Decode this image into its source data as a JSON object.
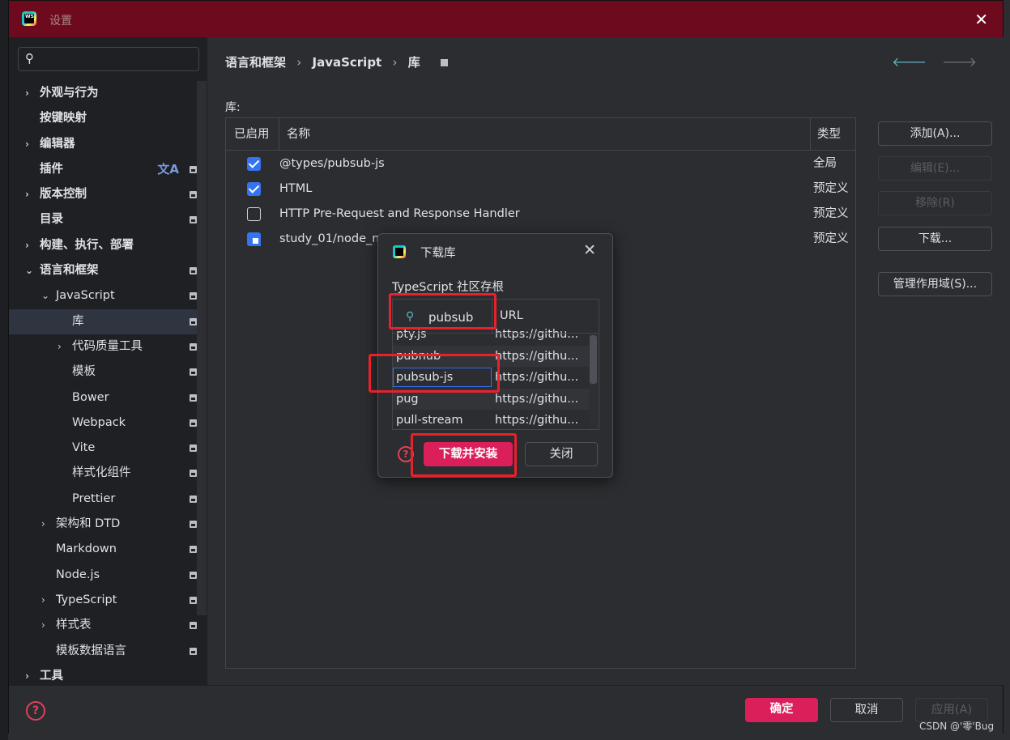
{
  "window": {
    "title": "设置",
    "close_glyph": "✕"
  },
  "sidebar": {
    "search_placeholder": "",
    "items": [
      {
        "label": "外观与行为",
        "chevron": "›",
        "bold": true
      },
      {
        "label": "按键映射",
        "bold": true
      },
      {
        "label": "编辑器",
        "chevron": "›",
        "bold": true
      },
      {
        "label": "插件",
        "bold": true
      },
      {
        "label": "版本控制",
        "chevron": "›",
        "bold": true
      },
      {
        "label": "目录",
        "bold": true
      },
      {
        "label": "构建、执行、部署",
        "chevron": "›",
        "bold": true
      },
      {
        "label": "语言和框架",
        "chevron": "⌄",
        "bold": true
      },
      {
        "label": "JavaScript",
        "chevron": "⌄"
      },
      {
        "label": "库"
      },
      {
        "label": "代码质量工具",
        "chevron": "›"
      },
      {
        "label": "模板"
      },
      {
        "label": "Bower"
      },
      {
        "label": "Webpack"
      },
      {
        "label": "Vite"
      },
      {
        "label": "样式化组件"
      },
      {
        "label": "Prettier"
      },
      {
        "label": "架构和 DTD",
        "chevron": "›"
      },
      {
        "label": "Markdown"
      },
      {
        "label": "Node.js"
      },
      {
        "label": "TypeScript",
        "chevron": "›"
      },
      {
        "label": "样式表",
        "chevron": "›"
      },
      {
        "label": "模板数据语言"
      },
      {
        "label": "工具",
        "chevron": "›",
        "bold": true
      }
    ]
  },
  "breadcrumb": [
    "语言和框架",
    "JavaScript",
    "库"
  ],
  "breadcrumb_sep": "›",
  "nav": {
    "back": "🡐",
    "forward": "🡒"
  },
  "libraries": {
    "label": "库:",
    "columns": [
      "已启用",
      "名称",
      "类型"
    ],
    "rows": [
      {
        "name": "@types/pubsub-js",
        "type": "全局",
        "state": "on"
      },
      {
        "name": "HTML",
        "type": "预定义",
        "state": "on"
      },
      {
        "name": "HTTP Pre-Request and Response Handler",
        "type": "预定义",
        "state": "off"
      },
      {
        "name": "study_01/node_m",
        "type": "预定义",
        "state": "partial"
      }
    ]
  },
  "side_buttons": [
    {
      "label": "添加(A)...",
      "enabled": true
    },
    {
      "label": "编辑(E)...",
      "enabled": false
    },
    {
      "label": "移除(R)",
      "enabled": false
    },
    {
      "label": "下载...",
      "enabled": true
    },
    {
      "label": "管理作用域(S)...",
      "enabled": true
    }
  ],
  "bottom": {
    "help": "?",
    "ok": "确定",
    "cancel": "取消",
    "apply": "应用(A)"
  },
  "dialog": {
    "title": "下载库",
    "subtitle": "TypeScript 社区存根",
    "search_value": "pubsub",
    "url_header": "URL",
    "rows": [
      {
        "name": "pty.js",
        "url": "https://githu..."
      },
      {
        "name": "pubnub",
        "url": "https://githu..."
      },
      {
        "name": "pubsub-js",
        "url": "https://githu...",
        "selected": true
      },
      {
        "name": "pug",
        "url": "https://githu..."
      },
      {
        "name": "pull-stream",
        "url": "https://githu..."
      }
    ],
    "help": "?",
    "primary": "下载并安装",
    "close": "关闭"
  },
  "watermark": "CSDN @'零'Bug",
  "colors": {
    "accent": "#db1f5b",
    "titlebar": "#6d0a1e",
    "checkbox": "#3574f0",
    "annotation": "#e8212b"
  }
}
